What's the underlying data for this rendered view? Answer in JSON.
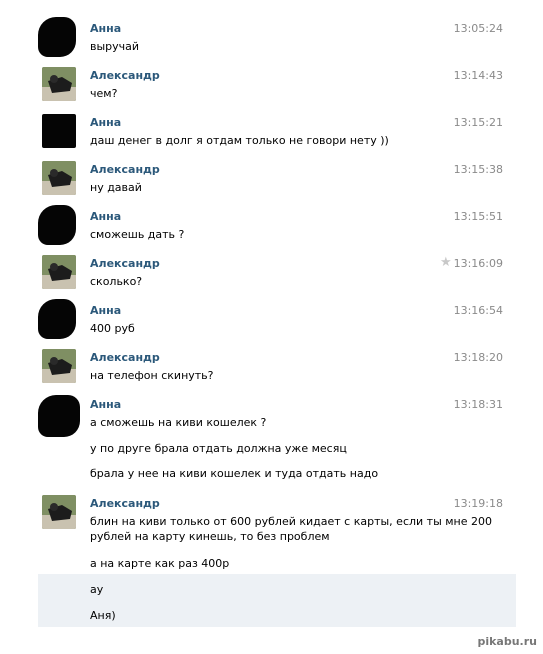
{
  "messages": [
    {
      "author": "Анна",
      "time": "13:05:24",
      "lines": [
        "выручай"
      ]
    },
    {
      "author": "Александр",
      "time": "13:14:43",
      "lines": [
        "чем?"
      ]
    },
    {
      "author": "Анна",
      "time": "13:15:21",
      "lines": [
        "даш денег в долг я отдам только не говори нету ))"
      ]
    },
    {
      "author": "Александр",
      "time": "13:15:38",
      "lines": [
        "ну давай"
      ]
    },
    {
      "author": "Анна",
      "time": "13:15:51",
      "lines": [
        "сможешь дать ?"
      ]
    },
    {
      "author": "Александр",
      "time": "13:16:09",
      "lines": [
        "сколько?"
      ]
    },
    {
      "author": "Анна",
      "time": "13:16:54",
      "lines": [
        "400 руб"
      ]
    },
    {
      "author": "Александр",
      "time": "13:18:20",
      "lines": [
        "на телефон скинуть?"
      ]
    },
    {
      "author": "Анна",
      "time": "13:18:31",
      "lines": [
        "а сможешь на киви кошелек ?",
        "у по друге брала отдать должна уже месяц",
        "брала у нее на киви кошелек и туда отдать надо"
      ]
    },
    {
      "author": "Александр",
      "time": "13:19:18",
      "lines": [
        "блин на киви только от 600 рублей кидает с карты, если ты мне 200",
        "рублей на карту кинешь, то без проблем",
        "а на карте как раз 400р"
      ]
    }
  ],
  "unread": [
    "ау",
    "Аня)"
  ],
  "watermark": "pikabu.ru",
  "colors": {
    "author": "#2b587a",
    "time": "#8a8a8a",
    "unread_bg": "#edf1f5"
  }
}
